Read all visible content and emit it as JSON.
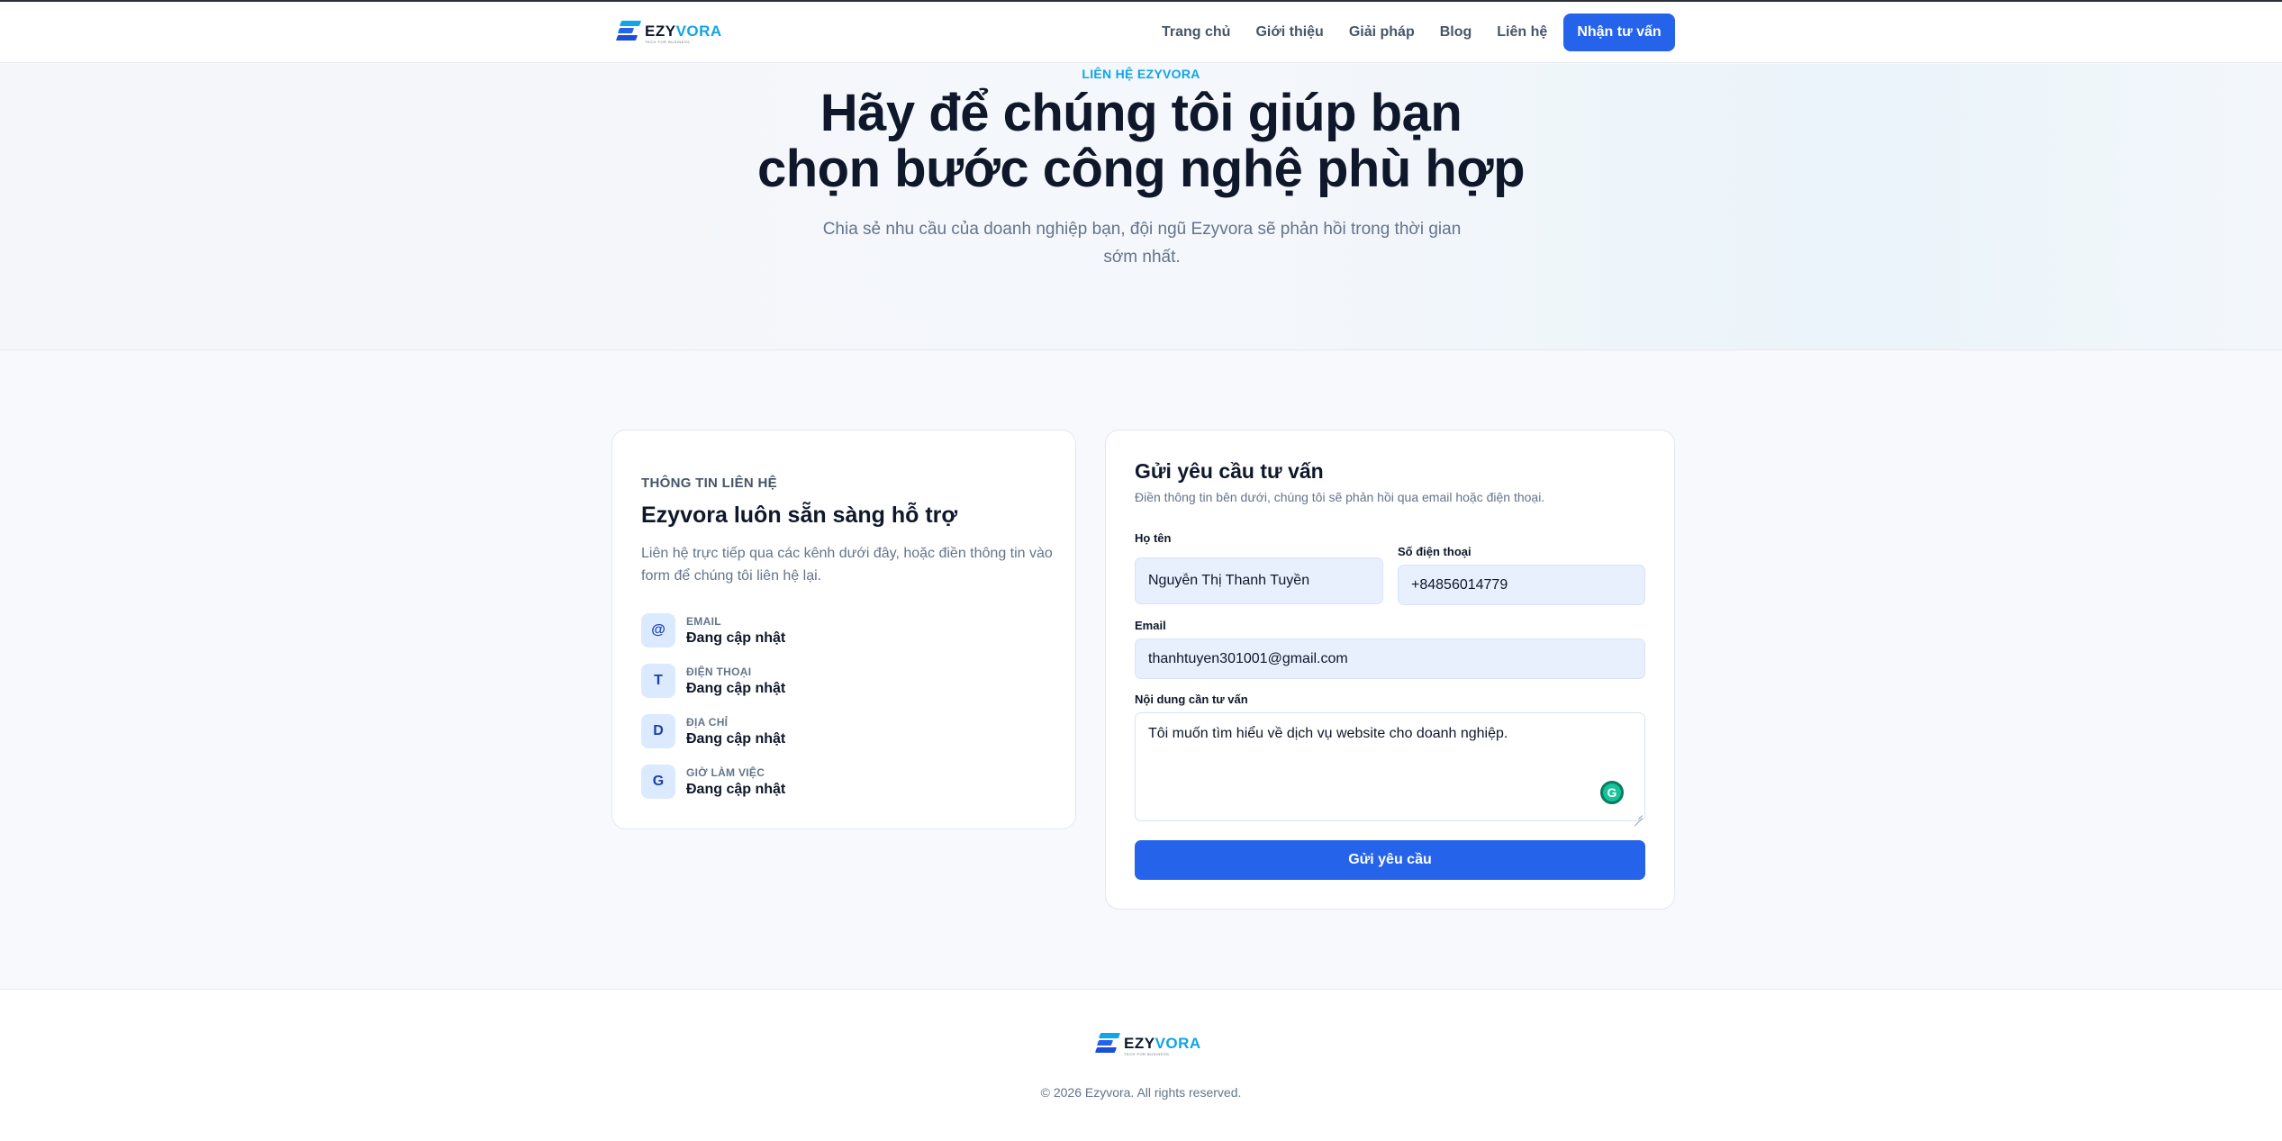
{
  "brand": {
    "name_part1": "EZY",
    "name_part2": "VORA",
    "tagline": "TECH FOR BUSINESS",
    "colors": {
      "primary": "#2563eb",
      "accent": "#0ea5e9",
      "text": "#0f172a"
    }
  },
  "nav": {
    "items": [
      "Trang chủ",
      "Giới thiệu",
      "Giải pháp",
      "Blog",
      "Liên hệ"
    ],
    "cta_label": "Nhận tư vấn"
  },
  "hero": {
    "kicker": "LIÊN HỆ EZYVORA",
    "title_line1": "Hãy để chúng tôi giúp bạn",
    "title_line2": "chọn bước công nghệ phù hợp",
    "subtitle": "Chia sẻ nhu cầu của doanh nghiệp bạn, đội ngũ Ezyvora sẽ phản hồi trong thời gian sớm nhất."
  },
  "contact_info": {
    "eyebrow": "THÔNG TIN LIÊN HỆ",
    "title": "Ezyvora luôn sẵn sàng hỗ trợ",
    "description": "Liên hệ trực tiếp qua các kênh dưới đây, hoặc điền thông tin vào form để chúng tôi liên hệ lại.",
    "items": [
      {
        "icon": "@",
        "label": "EMAIL",
        "value": "Đang cập nhật"
      },
      {
        "icon": "T",
        "label": "ĐIỆN THOẠI",
        "value": "Đang cập nhật"
      },
      {
        "icon": "D",
        "label": "ĐỊA CHỈ",
        "value": "Đang cập nhật"
      },
      {
        "icon": "G",
        "label": "GIỜ LÀM VIỆC",
        "value": "Đang cập nhật"
      }
    ]
  },
  "form": {
    "title": "Gửi yêu cầu tư vấn",
    "description": "Điền thông tin bên dưới, chúng tôi sẽ phản hồi qua email hoặc điện thoại.",
    "name_label": "Họ tên",
    "name_value": "Nguyễn Thị Thanh Tuyền",
    "phone_label": "Số điện thoại",
    "phone_value": "+84856014779",
    "email_label": "Email",
    "email_value": "thanhtuyen301001@gmail.com",
    "message_label": "Nội dung cần tư vấn",
    "message_value": "Tôi muốn tìm hiểu về dịch vụ website cho doanh nghiệp.",
    "submit_label": "Gửi yêu cầu"
  },
  "footer": {
    "copyright": "© 2026 Ezyvora. All rights reserved."
  }
}
